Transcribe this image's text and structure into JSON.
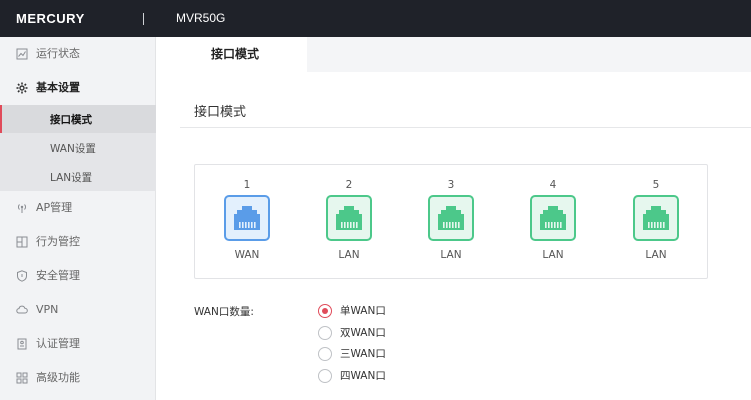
{
  "header": {
    "logo": "MERCURY",
    "model": "MVR50G"
  },
  "sidebar": {
    "items": [
      {
        "label": "运行状态",
        "icon": "chart-icon"
      },
      {
        "label": "基本设置",
        "icon": "gear-icon"
      },
      {
        "label": "AP管理",
        "icon": "ap-icon"
      },
      {
        "label": "行为管控",
        "icon": "behavior-icon"
      },
      {
        "label": "安全管理",
        "icon": "shield-icon"
      },
      {
        "label": "VPN",
        "icon": "cloud-icon"
      },
      {
        "label": "认证管理",
        "icon": "auth-icon"
      },
      {
        "label": "高级功能",
        "icon": "grid-icon"
      }
    ],
    "subitems": [
      {
        "label": "接口模式"
      },
      {
        "label": "WAN设置"
      },
      {
        "label": "LAN设置"
      }
    ]
  },
  "main": {
    "tab": "接口模式",
    "section_title": "接口模式",
    "ports": [
      {
        "num": "1",
        "type": "WAN"
      },
      {
        "num": "2",
        "type": "LAN"
      },
      {
        "num": "3",
        "type": "LAN"
      },
      {
        "num": "4",
        "type": "LAN"
      },
      {
        "num": "5",
        "type": "LAN"
      }
    ],
    "wan_count_label": "WAN口数量:",
    "wan_options": [
      {
        "label": "单WAN口"
      },
      {
        "label": "双WAN口"
      },
      {
        "label": "三WAN口"
      },
      {
        "label": "四WAN口"
      }
    ]
  },
  "colors": {
    "accent": "#e04b5a",
    "wan_port": "#5a9ce8",
    "lan_port": "#4cc88a",
    "header_bg": "#1f2229"
  }
}
